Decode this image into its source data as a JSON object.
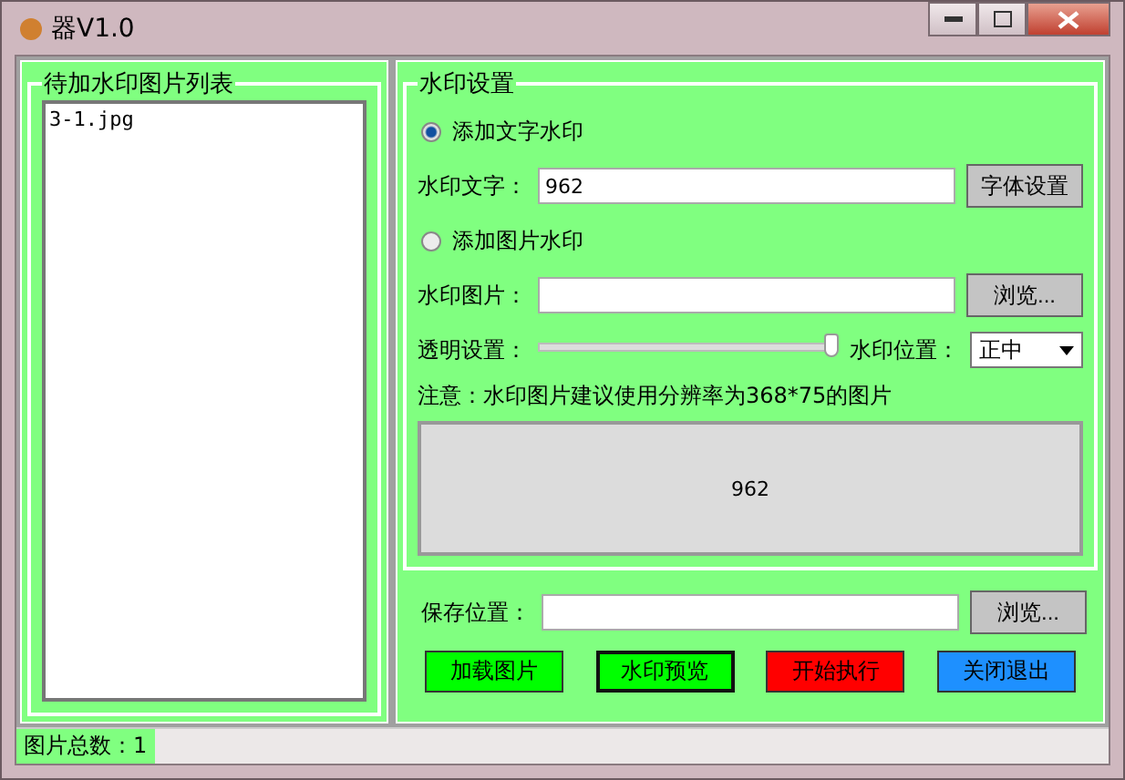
{
  "window": {
    "title": "器V1.0"
  },
  "file_list": {
    "title": "待加水印图片列表",
    "items": [
      "3-1.jpg"
    ]
  },
  "settings": {
    "title": "水印设置",
    "text_option": {
      "label": "添加文字水印",
      "selected": true
    },
    "text_field": {
      "label": "水印文字：",
      "value": "962",
      "button": "字体设置"
    },
    "image_option": {
      "label": "添加图片水印",
      "selected": false
    },
    "image_field": {
      "label": "水印图片：",
      "button": "浏览..."
    },
    "opacity": {
      "label": "透明设置：",
      "level": 1
    },
    "position": {
      "label": "水印位置：",
      "value": "正中"
    },
    "note": "注意：水印图片建议使用分辨率为368*75的图片",
    "preview": "962"
  },
  "save_field": {
    "label": "保存位置：",
    "button": "浏览..."
  },
  "buttons": [
    {
      "label": "加载图片",
      "color": "#00ff00",
      "focused": false
    },
    {
      "label": "水印预览",
      "color": "#00ff00",
      "focused": true
    },
    {
      "label": "开始执行",
      "color": "#ff0000",
      "focused": false
    },
    {
      "label": "关闭退出",
      "color": "#1e90ff",
      "focused": false
    }
  ],
  "status_bar": {
    "text": "图片总数：1"
  }
}
